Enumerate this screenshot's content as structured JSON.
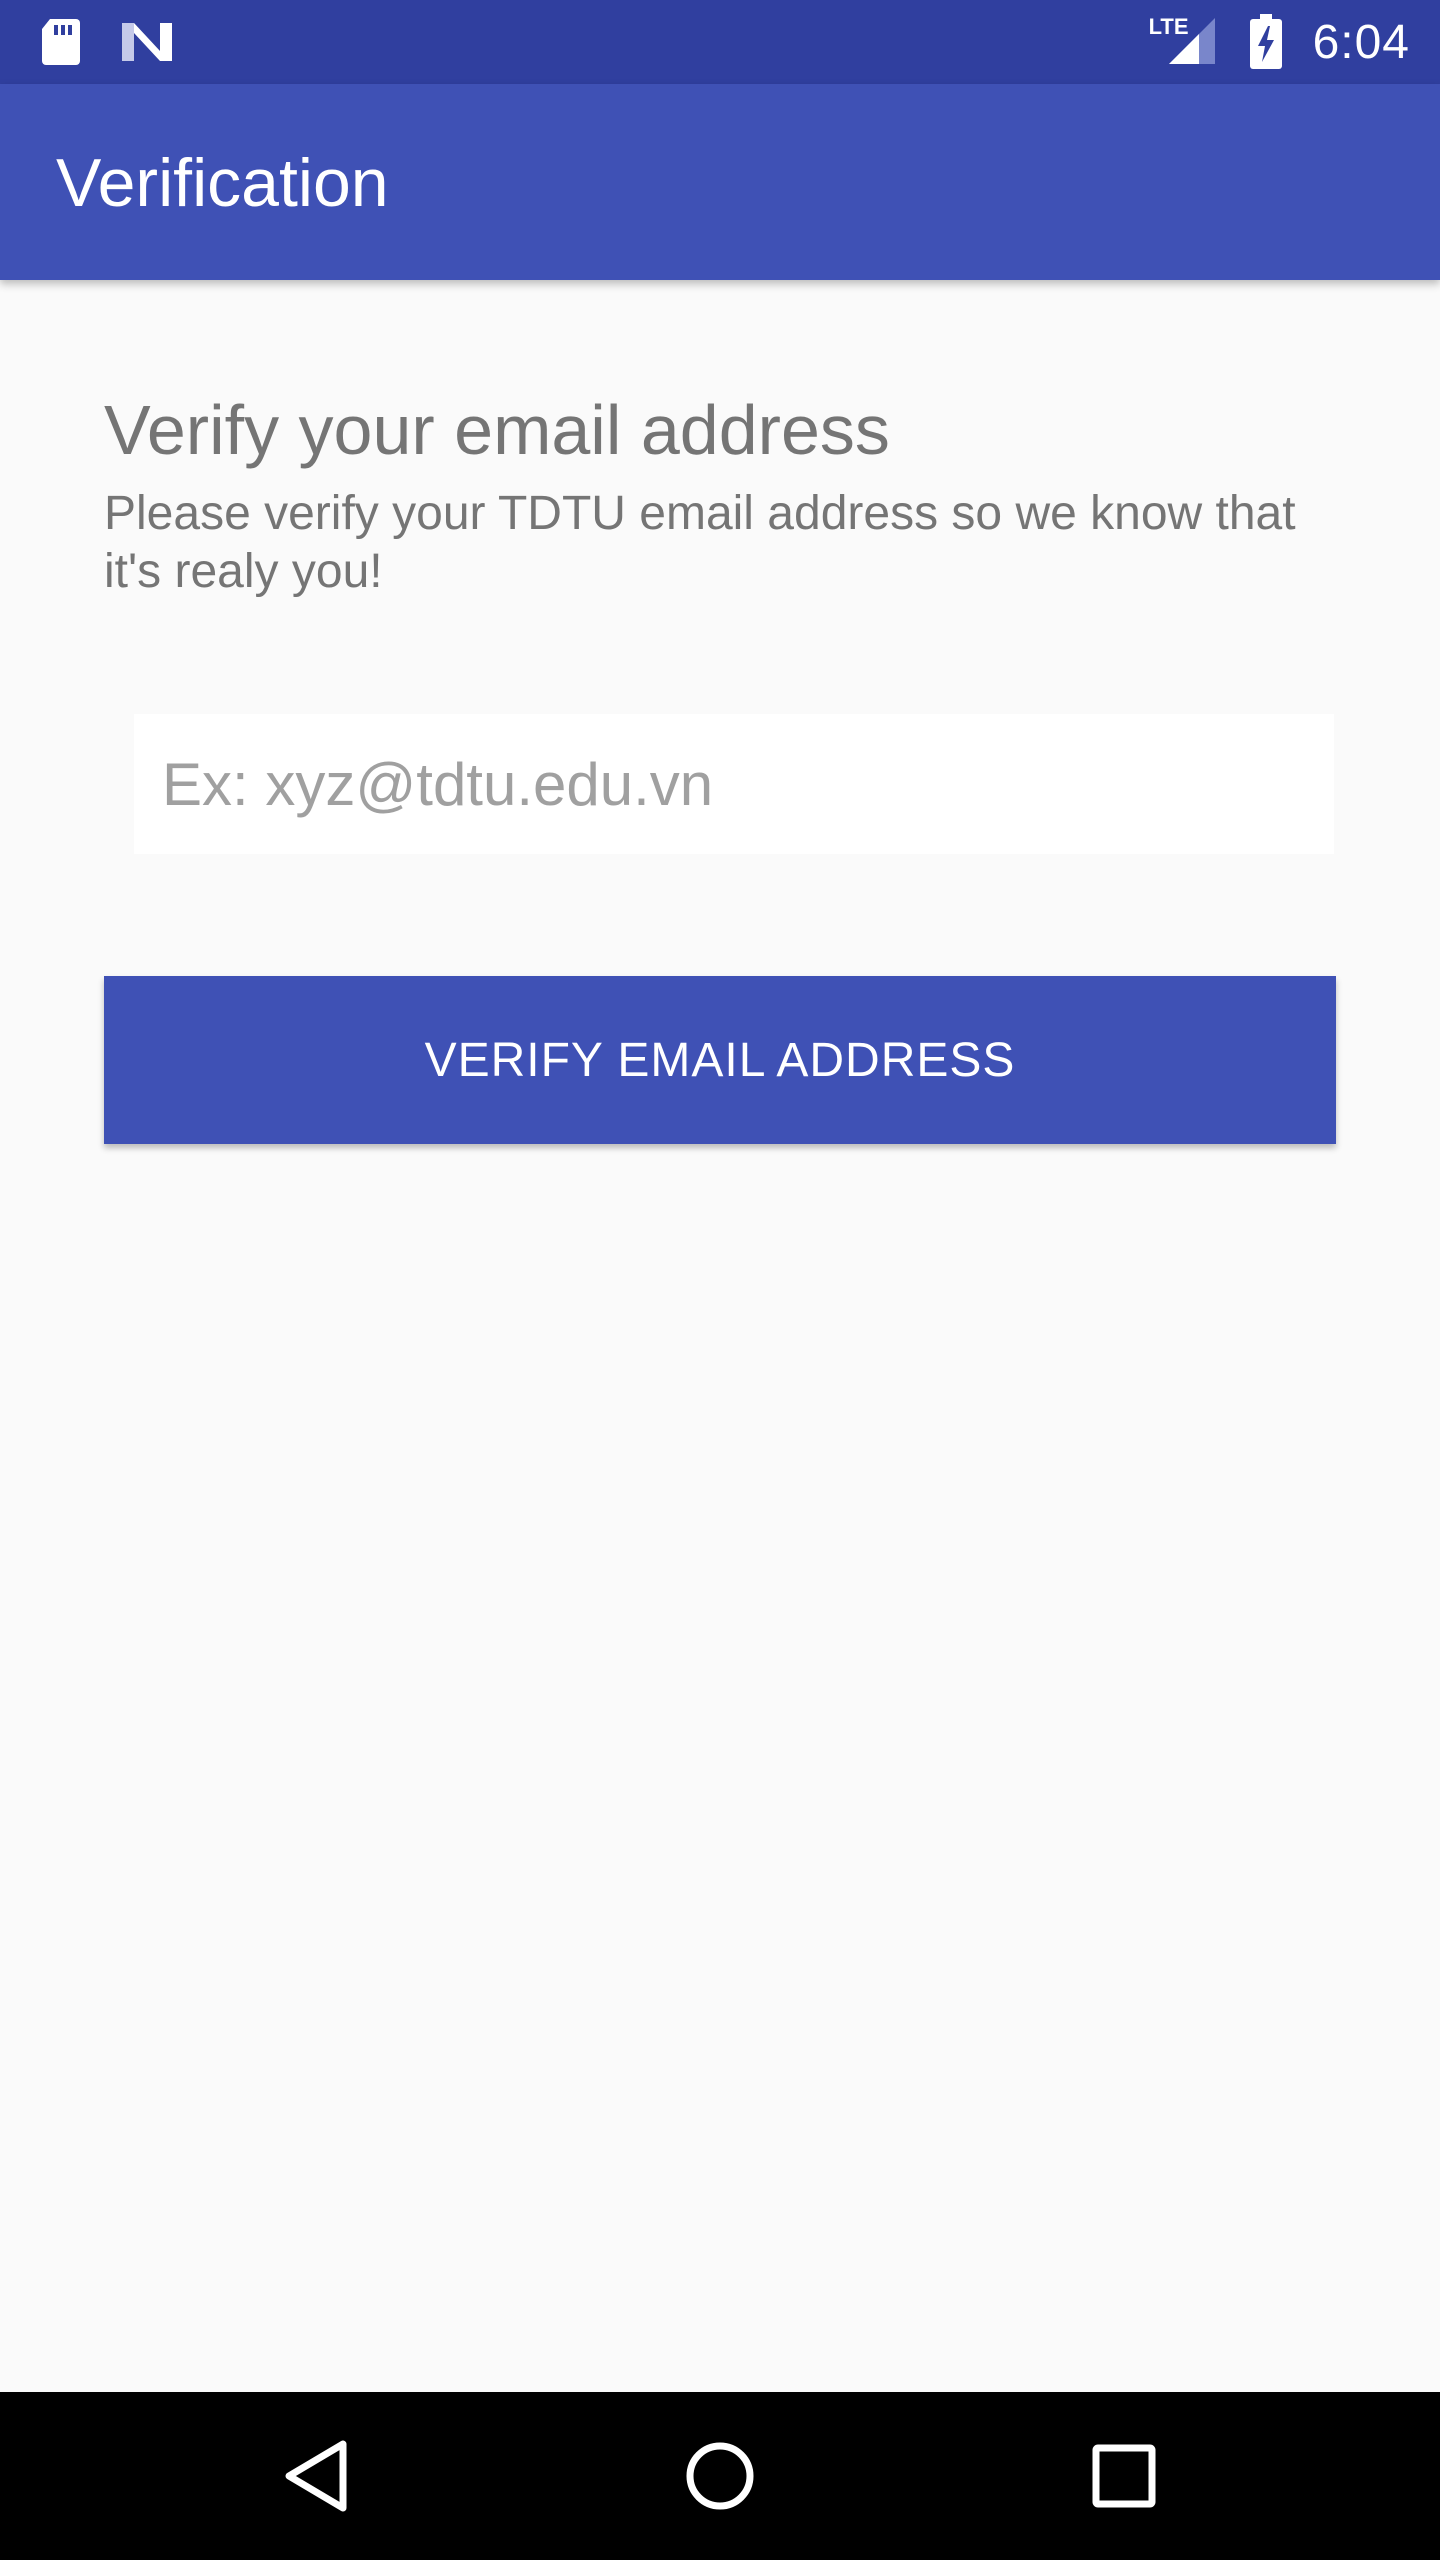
{
  "status_bar": {
    "time": "6:04",
    "network_label": "LTE",
    "icons": [
      "sd-card-icon",
      "n-logo-icon",
      "lte-signal-icon",
      "battery-charging-icon"
    ]
  },
  "app_bar": {
    "title": "Verification"
  },
  "main": {
    "heading": "Verify your email address",
    "description": "Please verify your TDTU email address so we know that it's realy you!",
    "email_input": {
      "value": "",
      "placeholder": "Ex: xyz@tdtu.edu.vn"
    },
    "verify_button_label": "VERIFY EMAIL ADDRESS"
  },
  "nav_bar": {
    "icons": [
      "back-icon",
      "home-icon",
      "recents-icon"
    ]
  },
  "colors": {
    "status_bar": "#303f9f",
    "primary": "#3f51b5",
    "background": "#fafafa",
    "text_secondary": "#757575"
  }
}
